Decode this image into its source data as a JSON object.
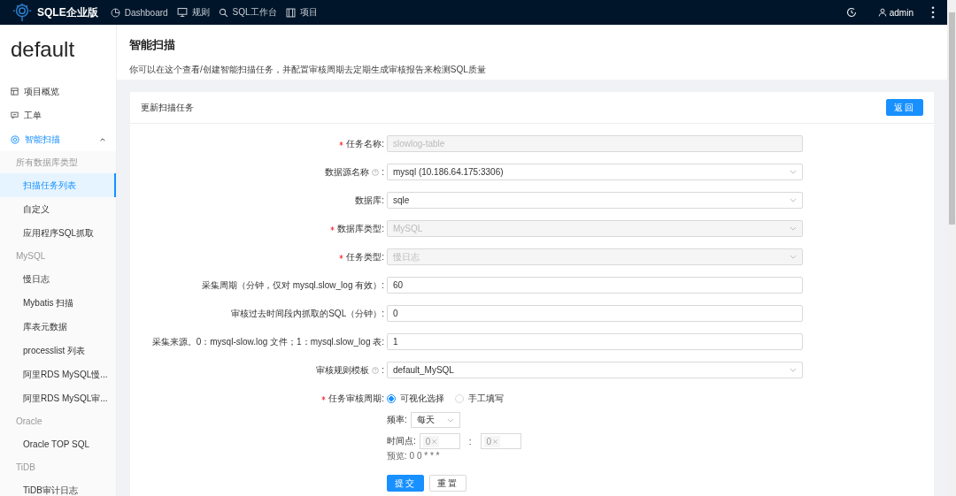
{
  "navbar": {
    "brand": "SQLE企业版",
    "items": [
      {
        "label": "Dashboard"
      },
      {
        "label": "规则"
      },
      {
        "label": "SQL工作台"
      },
      {
        "label": "项目"
      }
    ],
    "user": "admin"
  },
  "sidebar": {
    "project": "default",
    "menu": [
      {
        "label": "项目概览",
        "selected": false
      },
      {
        "label": "工单",
        "selected": false
      },
      {
        "label": "智能扫描",
        "selected": true,
        "expanded": true,
        "children": [
          {
            "kind": "group",
            "label": "所有数据库类型"
          },
          {
            "kind": "item",
            "label": "扫描任务列表",
            "selected": true
          },
          {
            "kind": "item",
            "label": "自定义",
            "selected": false
          },
          {
            "kind": "item",
            "label": "应用程序SQL抓取",
            "selected": false
          },
          {
            "kind": "group",
            "label": "MySQL"
          },
          {
            "kind": "item",
            "label": "慢日志",
            "selected": false
          },
          {
            "kind": "item",
            "label": "Mybatis 扫描",
            "selected": false
          },
          {
            "kind": "item",
            "label": "库表元数据",
            "selected": false
          },
          {
            "kind": "item",
            "label": "processlist 列表",
            "selected": false
          },
          {
            "kind": "item",
            "label": "阿里RDS MySQL慢...",
            "selected": false
          },
          {
            "kind": "item",
            "label": "阿里RDS MySQL审...",
            "selected": false
          },
          {
            "kind": "group",
            "label": "Oracle"
          },
          {
            "kind": "item",
            "label": "Oracle TOP SQL",
            "selected": false
          },
          {
            "kind": "group",
            "label": "TiDB"
          },
          {
            "kind": "item",
            "label": "TiDB审计日志",
            "selected": false
          }
        ]
      }
    ]
  },
  "page": {
    "title": "智能扫描",
    "description": "你可以在这个查看/创建智能扫描任务，并配置审核周期去定期生成审核报告来检测SQL质量"
  },
  "card": {
    "title": "更新扫描任务",
    "back_button": "返回",
    "fields": [
      {
        "kind": "input",
        "label": "任务名称:",
        "required": true,
        "help": false,
        "value": "slowlog-table",
        "disabled": true
      },
      {
        "kind": "select",
        "label": "数据源名称",
        "suffix": ":",
        "required": false,
        "help": true,
        "value": "mysql (10.186.64.175:3306)",
        "disabled": false
      },
      {
        "kind": "select",
        "label": "数据库:",
        "required": false,
        "help": false,
        "value": "sqle",
        "disabled": false
      },
      {
        "kind": "select",
        "label": "数据库类型:",
        "required": true,
        "help": false,
        "value": "MySQL",
        "disabled": true
      },
      {
        "kind": "select",
        "label": "任务类型:",
        "required": true,
        "help": false,
        "value": "慢日志",
        "disabled": true
      },
      {
        "kind": "input",
        "label": "采集周期（分钟，仅对 mysql.slow_log 有效）:",
        "required": false,
        "help": false,
        "value": "60",
        "disabled": false
      },
      {
        "kind": "input",
        "label": "审核过去时间段内抓取的SQL（分钟）:",
        "required": false,
        "help": false,
        "value": "0",
        "disabled": false
      },
      {
        "kind": "input",
        "label": "采集来源。0：mysql-slow.log 文件；1：mysql.slow_log 表:",
        "required": false,
        "help": false,
        "value": "1",
        "disabled": false
      },
      {
        "kind": "select",
        "label": "审核规则模板",
        "suffix": ":",
        "required": false,
        "help": true,
        "value": "default_MySQL",
        "disabled": false
      }
    ],
    "schedule": {
      "label": "任务审核周期:",
      "required": true,
      "options": [
        {
          "label": "可视化选择",
          "selected": true
        },
        {
          "label": "手工填写",
          "selected": false
        }
      ],
      "frequency_label": "频率:",
      "frequency": "每天",
      "time_label": "时间点:",
      "times": [
        "0",
        "0"
      ],
      "time_separator": ":",
      "preview": "预览: 0 0 * * *"
    },
    "buttons": [
      {
        "label": "提交",
        "primary": true
      },
      {
        "label": "重置",
        "primary": false
      }
    ]
  }
}
